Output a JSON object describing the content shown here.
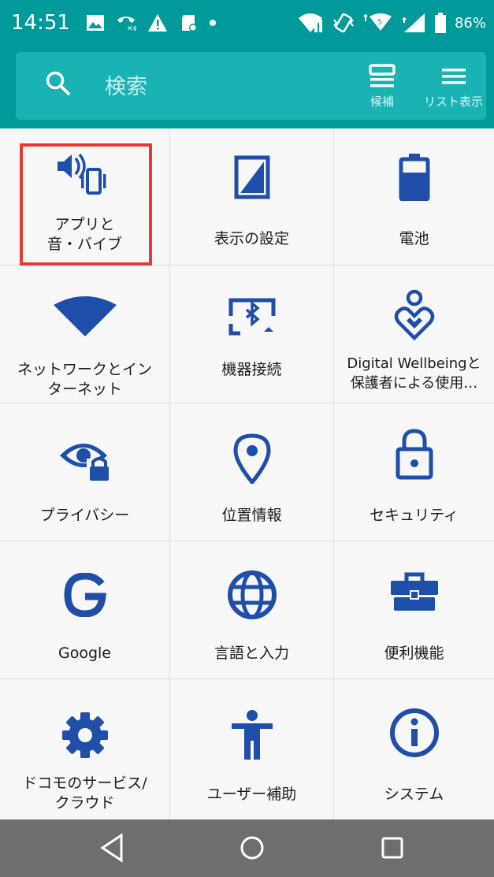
{
  "status_bar": {
    "time": "14:51",
    "battery_percent": "86%"
  },
  "header": {
    "search_placeholder": "検索",
    "candidates_label": "候補",
    "list_view_label": "リスト表示"
  },
  "tiles": [
    {
      "label": "アプリと\n音・バイブ",
      "icon": "sound-vibrate-icon"
    },
    {
      "label": "表示の設定",
      "icon": "display-icon"
    },
    {
      "label": "電池",
      "icon": "battery-icon"
    },
    {
      "label": "ネットワークとイン\nターネット",
      "icon": "wifi-icon"
    },
    {
      "label": "機器接続",
      "icon": "bluetooth-cast-icon"
    },
    {
      "label": "Digital Wellbeingと\n保護者による使用…",
      "icon": "wellbeing-icon"
    },
    {
      "label": "プライバシー",
      "icon": "privacy-eye-lock-icon"
    },
    {
      "label": "位置情報",
      "icon": "location-pin-icon"
    },
    {
      "label": "セキュリティ",
      "icon": "lock-icon"
    },
    {
      "label": "Google",
      "icon": "google-g-icon"
    },
    {
      "label": "言語と入力",
      "icon": "globe-icon"
    },
    {
      "label": "便利機能",
      "icon": "toolbox-icon"
    },
    {
      "label": "ドコモのサービス/\nクラウド",
      "icon": "gear-icon"
    },
    {
      "label": "ユーザー補助",
      "icon": "accessibility-icon"
    },
    {
      "label": "システム",
      "icon": "info-icon"
    }
  ],
  "colors": {
    "accent": "#009a9b",
    "icon_blue": "#1e4ea8",
    "highlight": "#e53935"
  }
}
